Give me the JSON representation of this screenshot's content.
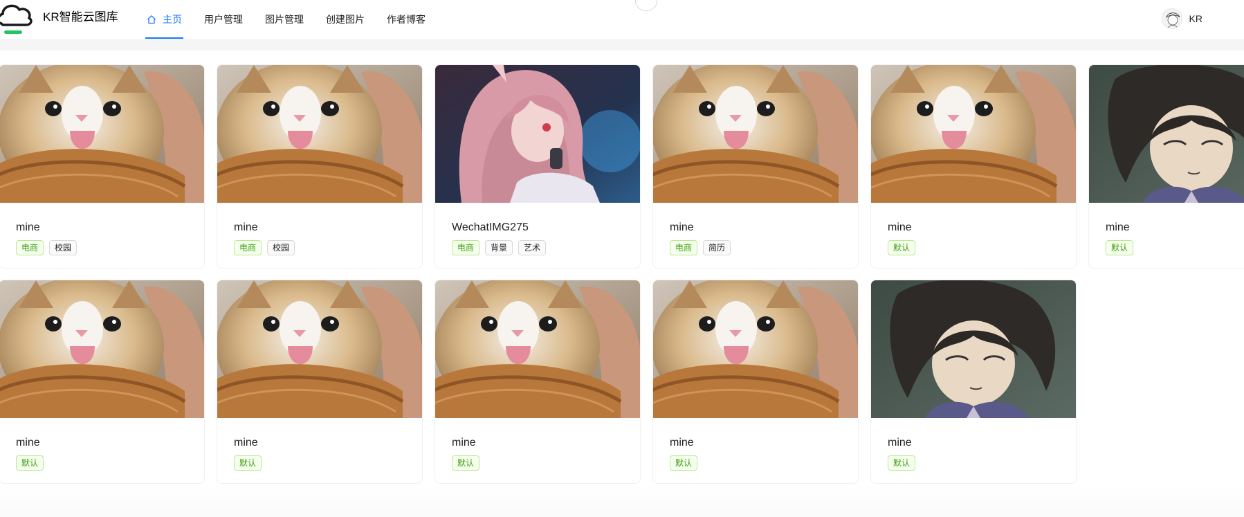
{
  "header": {
    "app_title": "KR智能云图库",
    "nav": [
      {
        "label": "主页",
        "icon": "home-icon",
        "active": true
      },
      {
        "label": "用户管理",
        "icon": "",
        "active": false
      },
      {
        "label": "图片管理",
        "icon": "",
        "active": false
      },
      {
        "label": "创建图片",
        "icon": "",
        "active": false
      },
      {
        "label": "作者博客",
        "icon": "",
        "active": false
      }
    ],
    "user": {
      "name": "KR",
      "avatar": "avatar-sketch"
    }
  },
  "colors": {
    "accent": "#1677ff",
    "tag_green": "#389e0d",
    "logo_green": "#22c55e"
  },
  "pictures": [
    {
      "title": "mine",
      "image": "cat-toast",
      "tags": [
        {
          "label": "电商",
          "green": true
        },
        {
          "label": "校园",
          "green": false
        }
      ]
    },
    {
      "title": "mine",
      "image": "cat-toast",
      "tags": [
        {
          "label": "电商",
          "green": true
        },
        {
          "label": "校园",
          "green": false
        }
      ]
    },
    {
      "title": "WechatIMG275",
      "image": "anime-girl",
      "tags": [
        {
          "label": "电商",
          "green": true
        },
        {
          "label": "背景",
          "green": false
        },
        {
          "label": "艺术",
          "green": false
        }
      ]
    },
    {
      "title": "mine",
      "image": "cat-toast",
      "tags": [
        {
          "label": "电商",
          "green": true
        },
        {
          "label": "简历",
          "green": false
        }
      ]
    },
    {
      "title": "mine",
      "image": "cat-toast",
      "tags": [
        {
          "label": "默认",
          "green": true
        }
      ]
    },
    {
      "title": "mine",
      "image": "anime-boy",
      "tags": [
        {
          "label": "默认",
          "green": true
        }
      ]
    },
    {
      "title": "mine",
      "image": "cat-toast",
      "tags": [
        {
          "label": "默认",
          "green": true
        }
      ]
    },
    {
      "title": "mine",
      "image": "cat-toast",
      "tags": [
        {
          "label": "默认",
          "green": true
        }
      ]
    },
    {
      "title": "mine",
      "image": "cat-toast",
      "tags": [
        {
          "label": "默认",
          "green": true
        }
      ]
    },
    {
      "title": "mine",
      "image": "cat-toast",
      "tags": [
        {
          "label": "默认",
          "green": true
        }
      ]
    },
    {
      "title": "mine",
      "image": "anime-boy",
      "tags": [
        {
          "label": "默认",
          "green": true
        }
      ]
    }
  ]
}
